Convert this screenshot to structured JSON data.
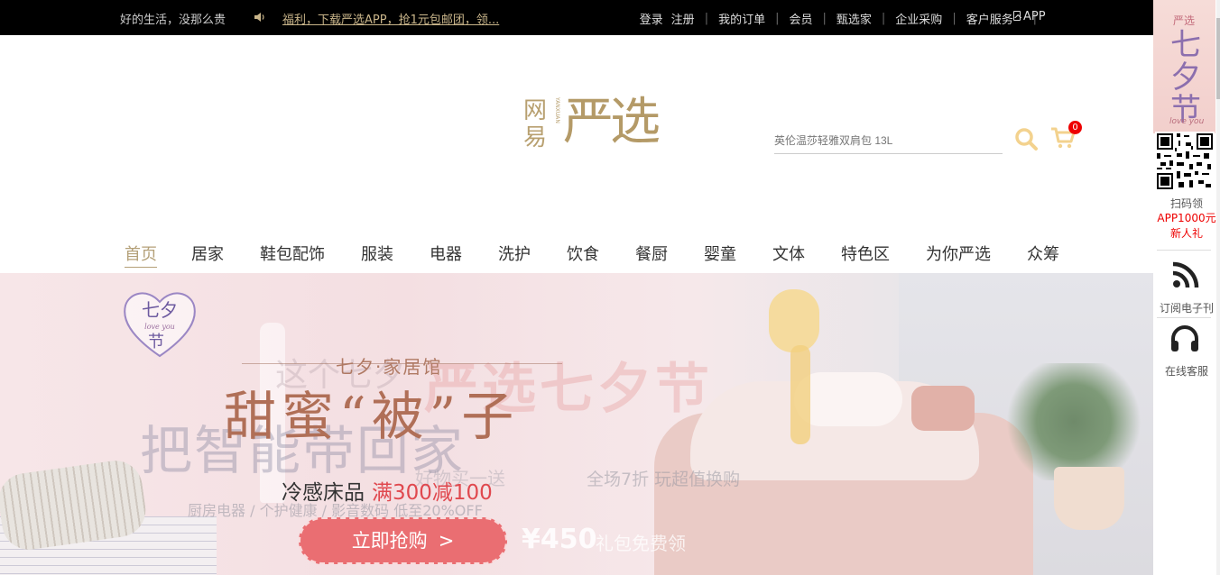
{
  "topbar": {
    "slogan": "好的生活，没那么贵",
    "promo": "福利，下载严选APP，抢1元包邮团，领...",
    "login": "登录",
    "register": "注册",
    "orders": "我的订单",
    "member": "会员",
    "picker": "甄选家",
    "enterprise": "企业采购",
    "service": "客户服务^",
    "app": "APP"
  },
  "logo": {
    "wangyi": "网易",
    "pinyin": "YANXUAN",
    "yanxuan": "严选"
  },
  "search": {
    "placeholder": "英伦温莎轻雅双肩包 13L"
  },
  "cart": {
    "count": "0"
  },
  "nav": {
    "items": [
      "首页",
      "居家",
      "鞋包配饰",
      "服装",
      "电器",
      "洗护",
      "饮食",
      "餐厨",
      "婴童",
      "文体",
      "特色区",
      "为你严选",
      "众筹"
    ]
  },
  "banner": {
    "badge_title": "七夕",
    "badge_sub": "love you",
    "badge_char": "节",
    "hall": "七夕·家居馆",
    "headline": "甜蜜“被”子",
    "subtitle": "冷感床品",
    "offer": "满300减100",
    "cta": "立即抢购",
    "cta_arrow": ">",
    "ghost_left": "把智能带回家",
    "ghost_top": "这个七夕",
    "ghost_brand": "严选七夕节",
    "ghost_mid": "好物买一送",
    "ghost_right": "全场7折 玩超值换购",
    "ghost_categories": "厨房电器 / 个护健康 / 影音数码  低至20%OFF",
    "ghost_price": "¥450",
    "ghost_gift": "礼包免费领"
  },
  "sidebar": {
    "promo_top": "严选",
    "promo_main": "七夕节",
    "promo_sub": "love you",
    "scan": "扫码领",
    "gift_line1": "APP1000元",
    "gift_line2": "新人礼",
    "subscribe": "订阅电子刊",
    "support": "在线客服"
  },
  "colors": {
    "gold": "#b4a078",
    "red": "#e0484e",
    "cta": "#ea6e72",
    "topbar": "#000000"
  }
}
